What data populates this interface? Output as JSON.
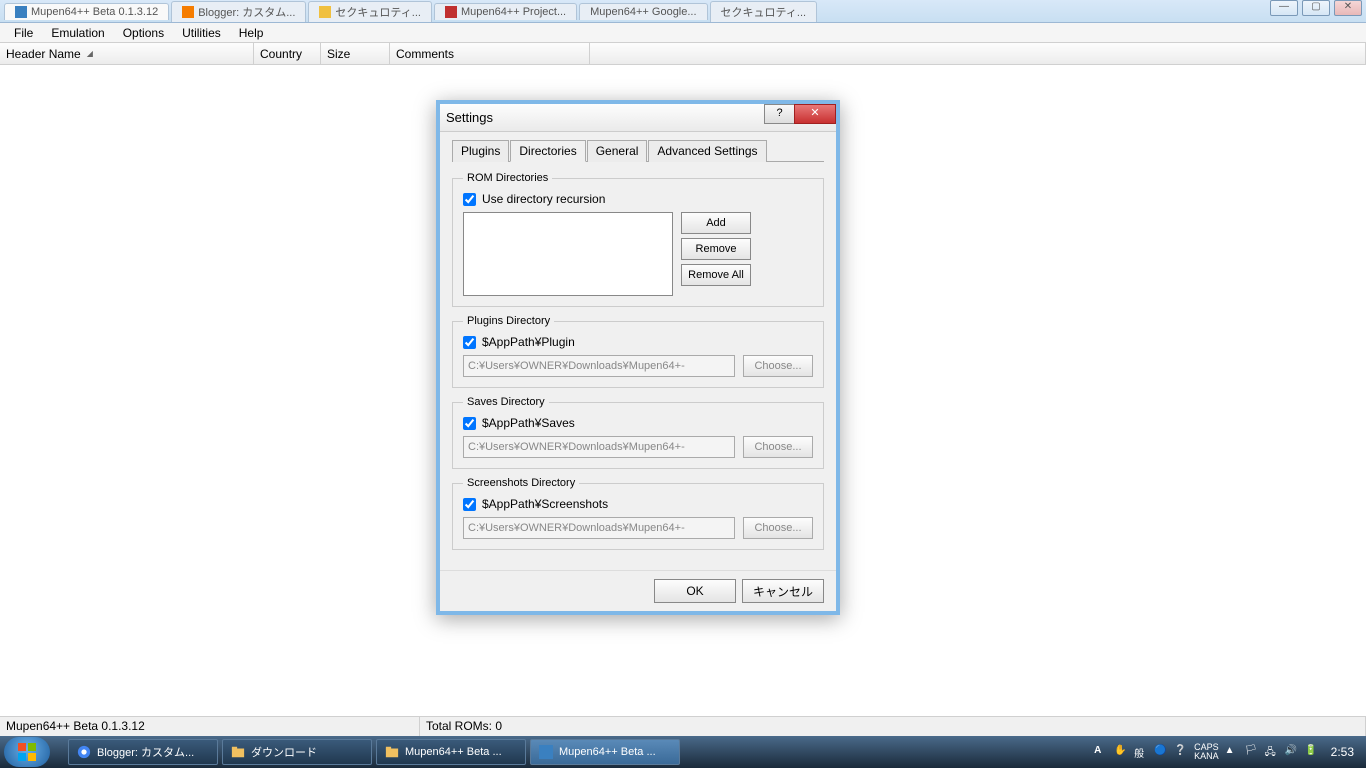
{
  "browser": {
    "tabs": [
      {
        "label": "Mupen64++ Beta 0.1.3.12"
      },
      {
        "label": "Blogger: カスタム..."
      },
      {
        "label": "セクキュロティ..."
      },
      {
        "label": "Mupen64++   Project..."
      },
      {
        "label": "Mupen64++  Google..."
      },
      {
        "label": "セクキュロティ..."
      }
    ],
    "win_min": "—",
    "win_max": "▢",
    "win_close": "✕"
  },
  "menu": {
    "file": "File",
    "emulation": "Emulation",
    "options": "Options",
    "utilities": "Utilities",
    "help": "Help"
  },
  "table": {
    "header_name": "Header Name",
    "country": "Country",
    "size": "Size",
    "comments": "Comments"
  },
  "status": {
    "left": "Mupen64++ Beta 0.1.3.12",
    "right": "Total ROMs: 0"
  },
  "dialog": {
    "title": "Settings",
    "help": "?",
    "close": "✕",
    "tabs": {
      "plugins": "Plugins",
      "directories": "Directories",
      "general": "General",
      "advanced": "Advanced Settings"
    },
    "rom": {
      "legend": "ROM Directories",
      "recursion": "Use directory recursion",
      "add": "Add",
      "remove": "Remove",
      "remove_all": "Remove All"
    },
    "plugins_dir": {
      "legend": "Plugins Directory",
      "check": "$AppPath¥Plugin",
      "path": "C:¥Users¥OWNER¥Downloads¥Mupen64+-",
      "choose": "Choose..."
    },
    "saves_dir": {
      "legend": "Saves Directory",
      "check": "$AppPath¥Saves",
      "path": "C:¥Users¥OWNER¥Downloads¥Mupen64+-",
      "choose": "Choose..."
    },
    "screens_dir": {
      "legend": "Screenshots Directory",
      "check": "$AppPath¥Screenshots",
      "path": "C:¥Users¥OWNER¥Downloads¥Mupen64+-",
      "choose": "Choose..."
    },
    "ok": "OK",
    "cancel": "キャンセル"
  },
  "taskbar": {
    "items": [
      {
        "label": "Blogger: カスタム..."
      },
      {
        "label": "ダウンロード"
      },
      {
        "label": "Mupen64++ Beta ..."
      },
      {
        "label": "Mupen64++ Beta ..."
      }
    ],
    "ime_caps": "CAPS",
    "ime_kana": "KANA",
    "clock": "2:53"
  }
}
